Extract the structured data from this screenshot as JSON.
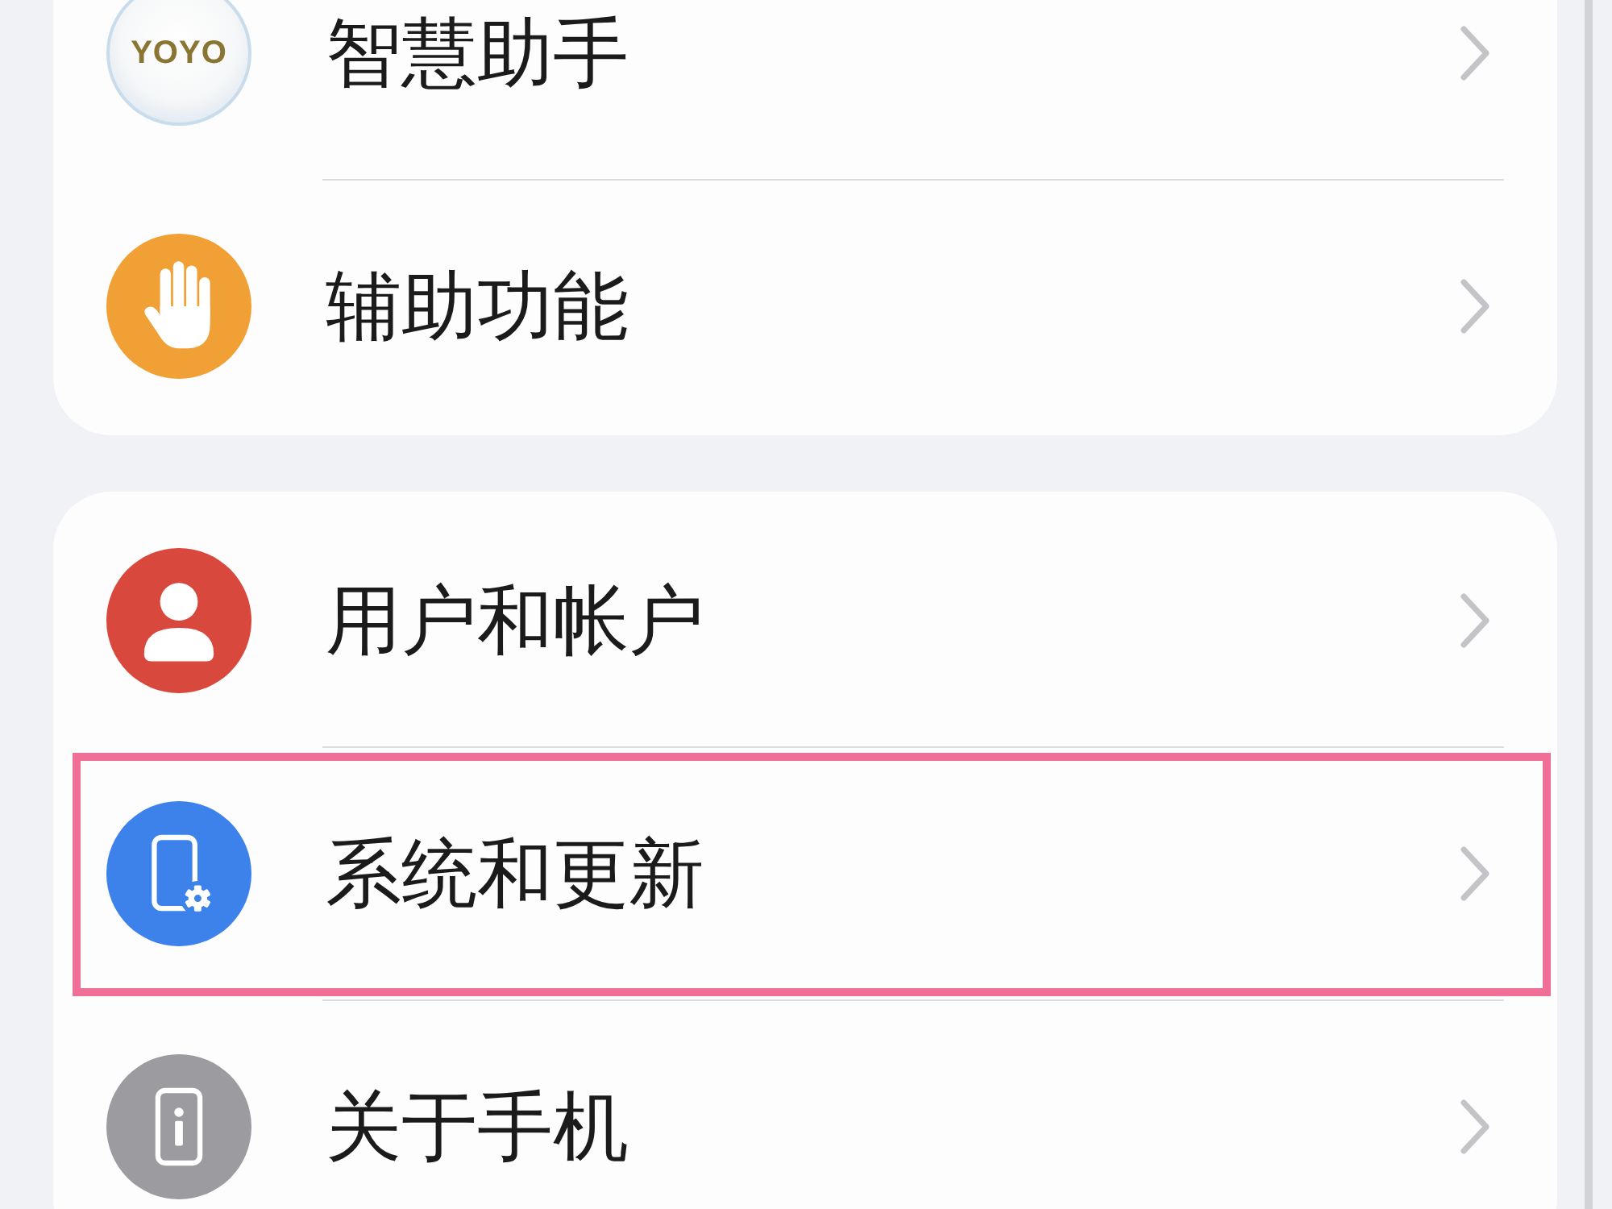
{
  "sections": [
    {
      "items": [
        {
          "kind": "assistant",
          "icon_text": "YOYO",
          "label": "智慧助手",
          "highlighted": false
        },
        {
          "kind": "accessibility",
          "label": "辅助功能",
          "highlighted": false
        }
      ]
    },
    {
      "items": [
        {
          "kind": "users",
          "label": "用户和帐户",
          "highlighted": false
        },
        {
          "kind": "system",
          "label": "系统和更新",
          "highlighted": true
        },
        {
          "kind": "about",
          "label": "关于手机",
          "highlighted": false
        }
      ]
    }
  ]
}
